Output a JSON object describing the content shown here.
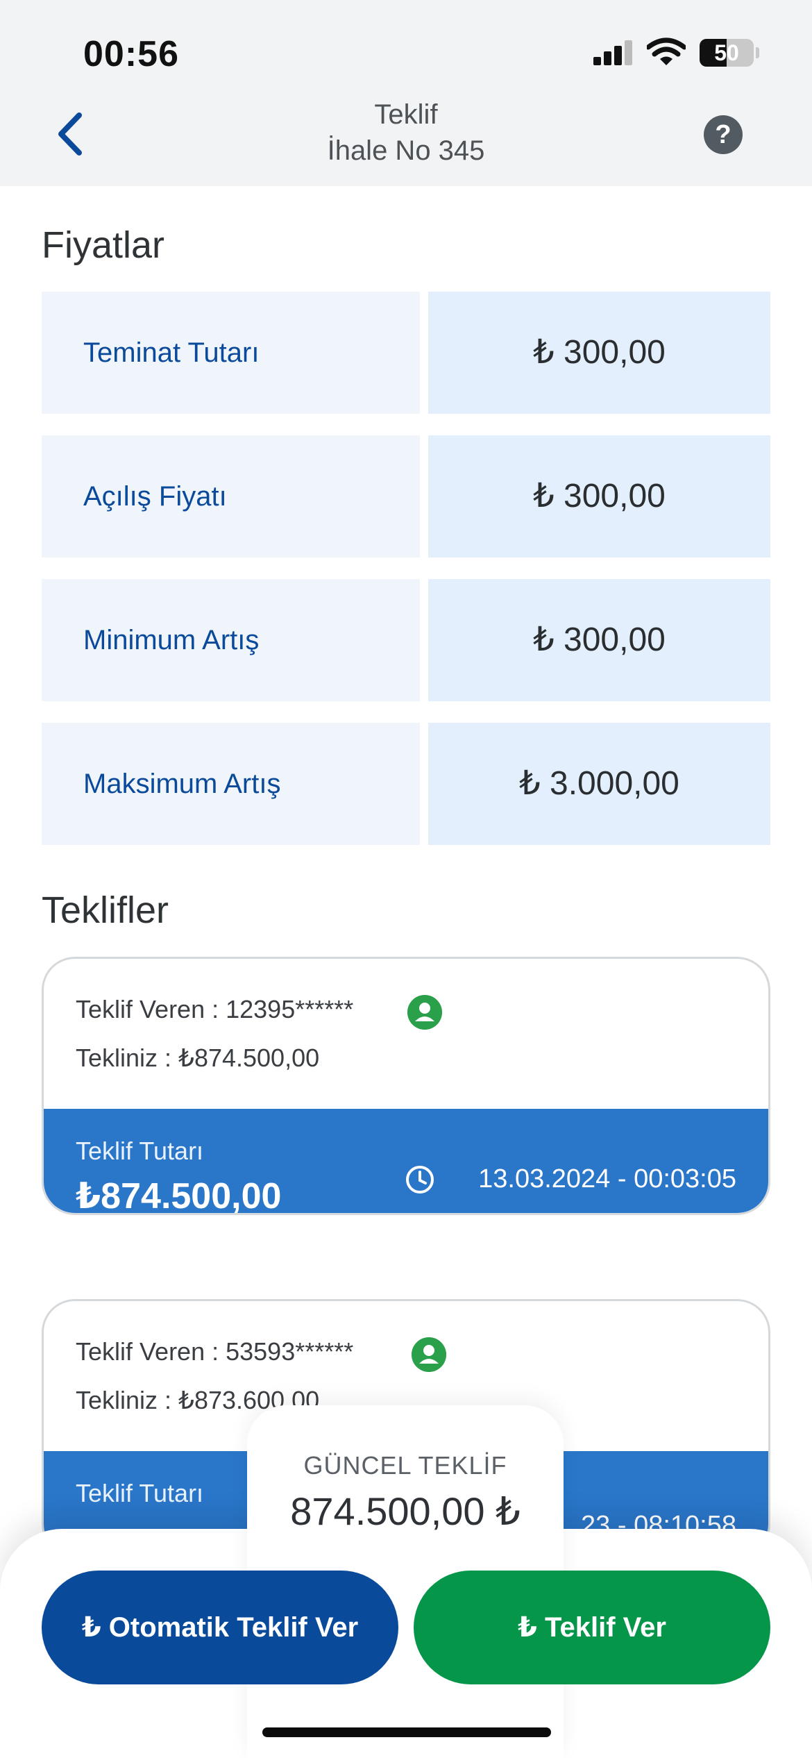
{
  "status_bar": {
    "time": "00:56",
    "battery": "50"
  },
  "nav": {
    "title": "Teklif",
    "subtitle": "İhale No 345",
    "help": "?"
  },
  "prices": {
    "title": "Fiyatlar",
    "rows": [
      {
        "label": "Teminat Tutarı",
        "value": "₺ 300,00"
      },
      {
        "label": "Açılış Fiyatı",
        "value": "₺ 300,00"
      },
      {
        "label": "Minimum Artış",
        "value": "₺ 300,00"
      },
      {
        "label": "Maksimum Artış",
        "value": "₺ 3.000,00"
      }
    ]
  },
  "bids": {
    "title": "Teklifler",
    "items": [
      {
        "bidder": "Teklif Veren : 12395******",
        "your_bid": "Tekliniz : ₺874.500,00",
        "amount_label": "Teklif Tutarı",
        "amount": "₺874.500,00",
        "datetime": "13.03.2024 - 00:03:05"
      },
      {
        "bidder": "Teklif Veren : 53593******",
        "your_bid": "Tekliniz : ₺873.600,00",
        "amount_label": "Teklif Tutarı",
        "amount": "",
        "datetime": "23 - 08:10:58"
      }
    ]
  },
  "current_offer": {
    "label": "GÜNCEL TEKLİF",
    "value": "874.500,00 ₺"
  },
  "actions": {
    "auto_bid": "₺ Otomatik Teklif Ver",
    "bid": "₺ Teklif Ver"
  },
  "colors": {
    "primary": "#0a4a9b",
    "card_blue": "#2a76c9",
    "green": "#05964a",
    "label_bg": "#eff5fb",
    "value_bg": "#e3effc"
  }
}
